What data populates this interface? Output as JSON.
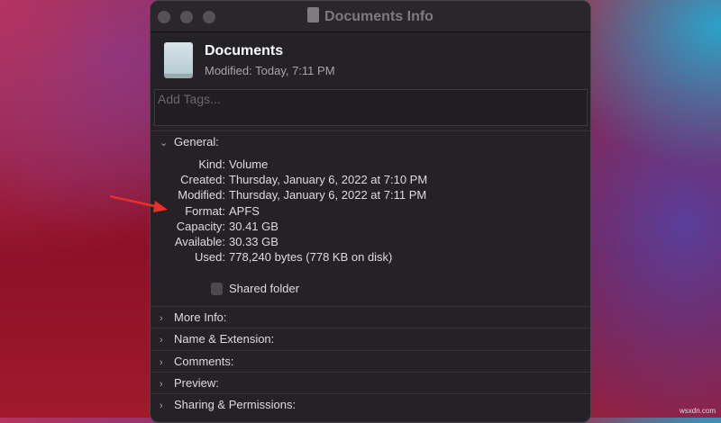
{
  "window": {
    "title": "Documents Info"
  },
  "header": {
    "name": "Documents",
    "modified": "Modified: Today, 7:11 PM"
  },
  "tags": {
    "placeholder": "Add Tags..."
  },
  "general": {
    "label": "General:",
    "rows": [
      {
        "k": "Kind:",
        "v": "Volume"
      },
      {
        "k": "Created:",
        "v": "Thursday, January 6, 2022 at 7:10 PM"
      },
      {
        "k": "Modified:",
        "v": "Thursday, January 6, 2022 at 7:11 PM"
      },
      {
        "k": "Format:",
        "v": "APFS"
      },
      {
        "k": "Capacity:",
        "v": "30.41 GB"
      },
      {
        "k": "Available:",
        "v": "30.33 GB"
      },
      {
        "k": "Used:",
        "v": "778,240 bytes (778 KB on disk)"
      }
    ],
    "shared_folder": "Shared folder",
    "shared_checked": false
  },
  "sections": [
    "More Info:",
    "Name & Extension:",
    "Comments:",
    "Preview:",
    "Sharing & Permissions:"
  ],
  "annotation_color": "#e8302a",
  "watermark": "wsxdn.com"
}
